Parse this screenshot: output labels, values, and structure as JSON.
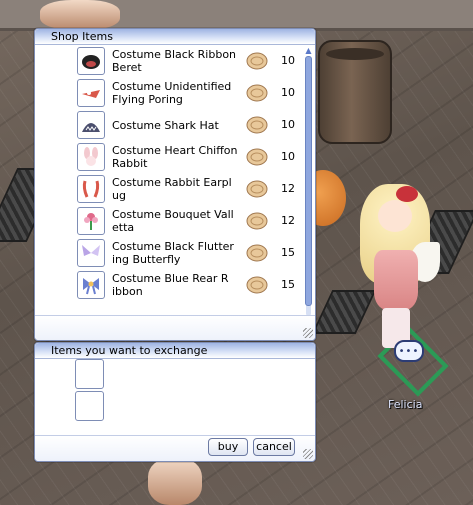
{
  "shop_window": {
    "title": "Shop Items",
    "items": [
      {
        "name": "Costume Black Ribbon\n Beret",
        "price": "10",
        "icon": "black-ribbon-beret-icon"
      },
      {
        "name": "Costume Unidentified\nFlying Poring",
        "price": "10",
        "icon": "flying-poring-icon"
      },
      {
        "name": "Costume Shark Hat",
        "price": "10",
        "icon": "shark-hat-icon"
      },
      {
        "name": "Costume Heart Chiffon\n Rabbit",
        "price": "10",
        "icon": "heart-chiffon-rabbit-icon"
      },
      {
        "name": "Costume Rabbit Earpl\nug",
        "price": "12",
        "icon": "rabbit-earplug-icon"
      },
      {
        "name": "Costume Bouquet Vall\netta",
        "price": "12",
        "icon": "bouquet-valletta-icon"
      },
      {
        "name": "Costume Black Flutter\ning Butterfly",
        "price": "15",
        "icon": "black-fluttering-butterfly-icon"
      },
      {
        "name": "Costume Blue Rear R\nibbon",
        "price": "15",
        "icon": "blue-rear-ribbon-icon"
      }
    ]
  },
  "exchange_window": {
    "title": "Items you want to exchange",
    "buy_label": "buy",
    "cancel_label": "cancel"
  },
  "npc": {
    "name": "Felicia",
    "chat_bubble": "•••"
  },
  "colors": {
    "window_border": "#7e8db5",
    "titlebar": "#9fb4e3",
    "scroll_thumb": "#8ea6de",
    "coin": "#e8c89a"
  }
}
